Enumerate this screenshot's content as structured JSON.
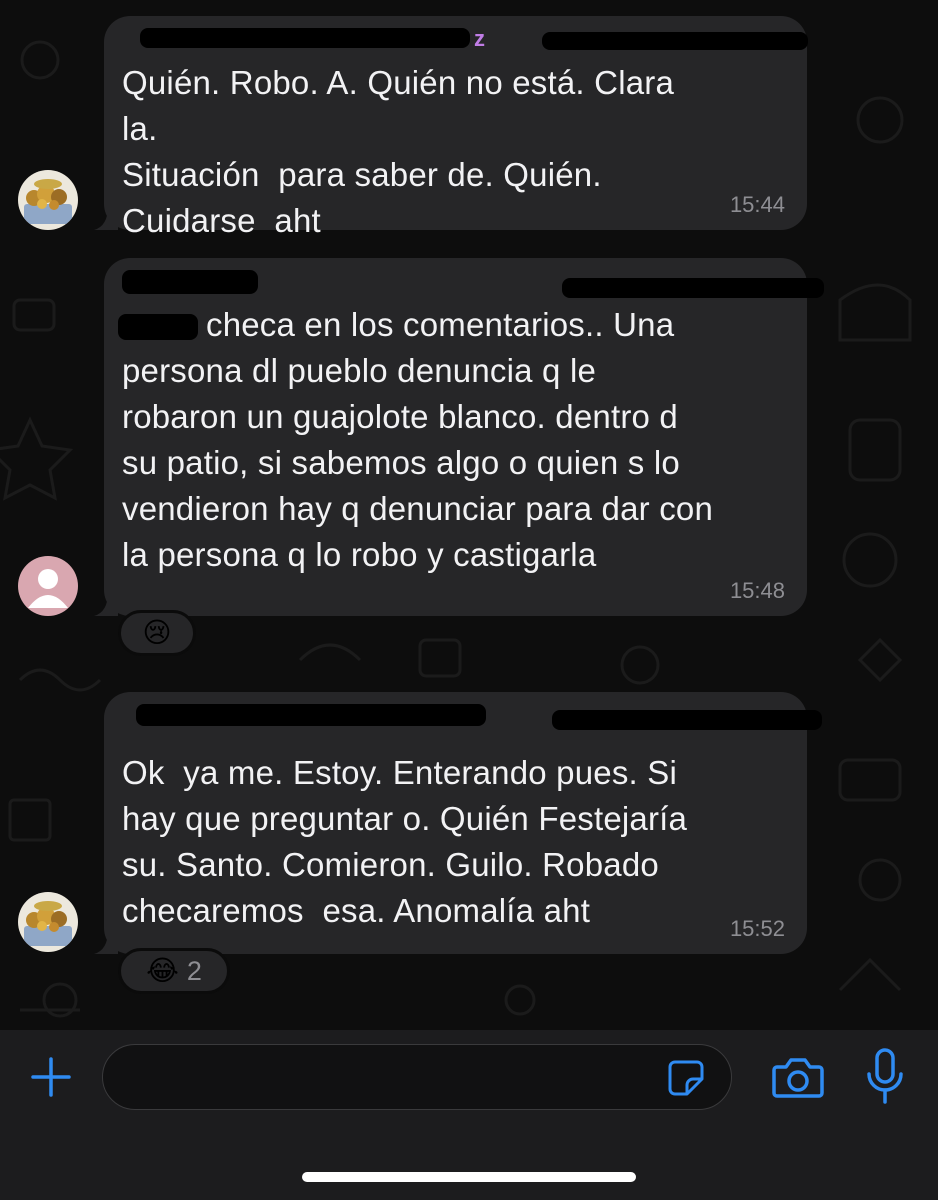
{
  "messages": [
    {
      "text": "Quién. Robo. A. Quién no está. Clara la.\nSituación  para saber de. Quién.\nCuidarse  aht",
      "time": "15:44",
      "sender_fragment": "z",
      "avatar": "fruit-basket-avatar"
    },
    {
      "text": "checa en los comentarios.. Una\npersona dl pueblo denuncia q le\nrobaron un guajolote blanco. dentro d\nsu patio, si sabemos algo o quien s lo\nvendieron hay q denunciar para dar con\nla persona q lo robo y castigarla",
      "time": "15:48",
      "avatar": "default-person-avatar",
      "reaction": {
        "emoji": "😢",
        "icon": "crying-face-icon"
      }
    },
    {
      "text": "Ok  ya me. Estoy. Enterando pues. Si\nhay que preguntar o. Quién Festejaría\nsu. Santo. Comieron. Guilo. Robado\nchecaremos  esa. Anomalía aht",
      "time": "15:52",
      "avatar": "fruit-basket-avatar",
      "reaction": {
        "emoji": "😂",
        "icon": "tears-of-joy-icon",
        "count": "2"
      }
    }
  ],
  "composer": {
    "placeholder": "",
    "icons": [
      "plus-icon",
      "sticker-icon",
      "camera-icon",
      "microphone-icon"
    ]
  },
  "colors": {
    "accent": "#2f8bf2",
    "bubble": "#262628",
    "text": "#f2f2f4",
    "timestamp": "#8e8e93",
    "sender": "#c07de6"
  }
}
